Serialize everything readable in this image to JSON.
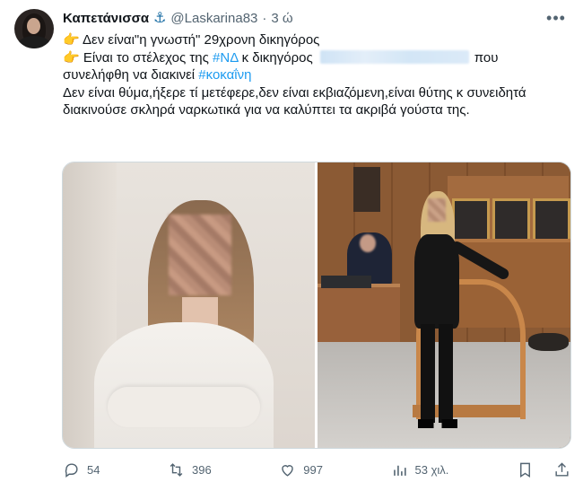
{
  "tweet": {
    "display_name": "Καπετάνισσα",
    "badge_icon": "anchor-icon",
    "handle": "@Laskarina83",
    "separator": "·",
    "time": "3 ώ",
    "more_icon": "more-options-icon",
    "lines": {
      "l1_text": "Δεν είναι\"η γνωστή\" 29χρονη δικηγόρος",
      "l2_before": "Είναι το στέλεχος της ",
      "l2_hashtag": "#ΝΔ",
      "l2_after": " κ δικηγόρος",
      "l2_end": "που",
      "l3_text": "συνελήφθη να διακινεί ",
      "l3_hashtag": "#κοκαΐνη",
      "l4_text": "Δεν είναι θύμα,ήξερε τί μετέφερε,δεν είναι εκβιαζόμενη,είναι θύτης κ συνειδητά διακινούσε σκληρά ναρκωτικά για να καλύπτει τα ακριβά γούστα της."
    },
    "emoji": "👉"
  },
  "actions": {
    "replies": "54",
    "reposts": "396",
    "likes": "997",
    "views": "53 χιλ."
  },
  "colors": {
    "text": "#0f1419",
    "secondary": "#536471",
    "link": "#1d9bf0",
    "anchor": "#1d6fa5"
  }
}
